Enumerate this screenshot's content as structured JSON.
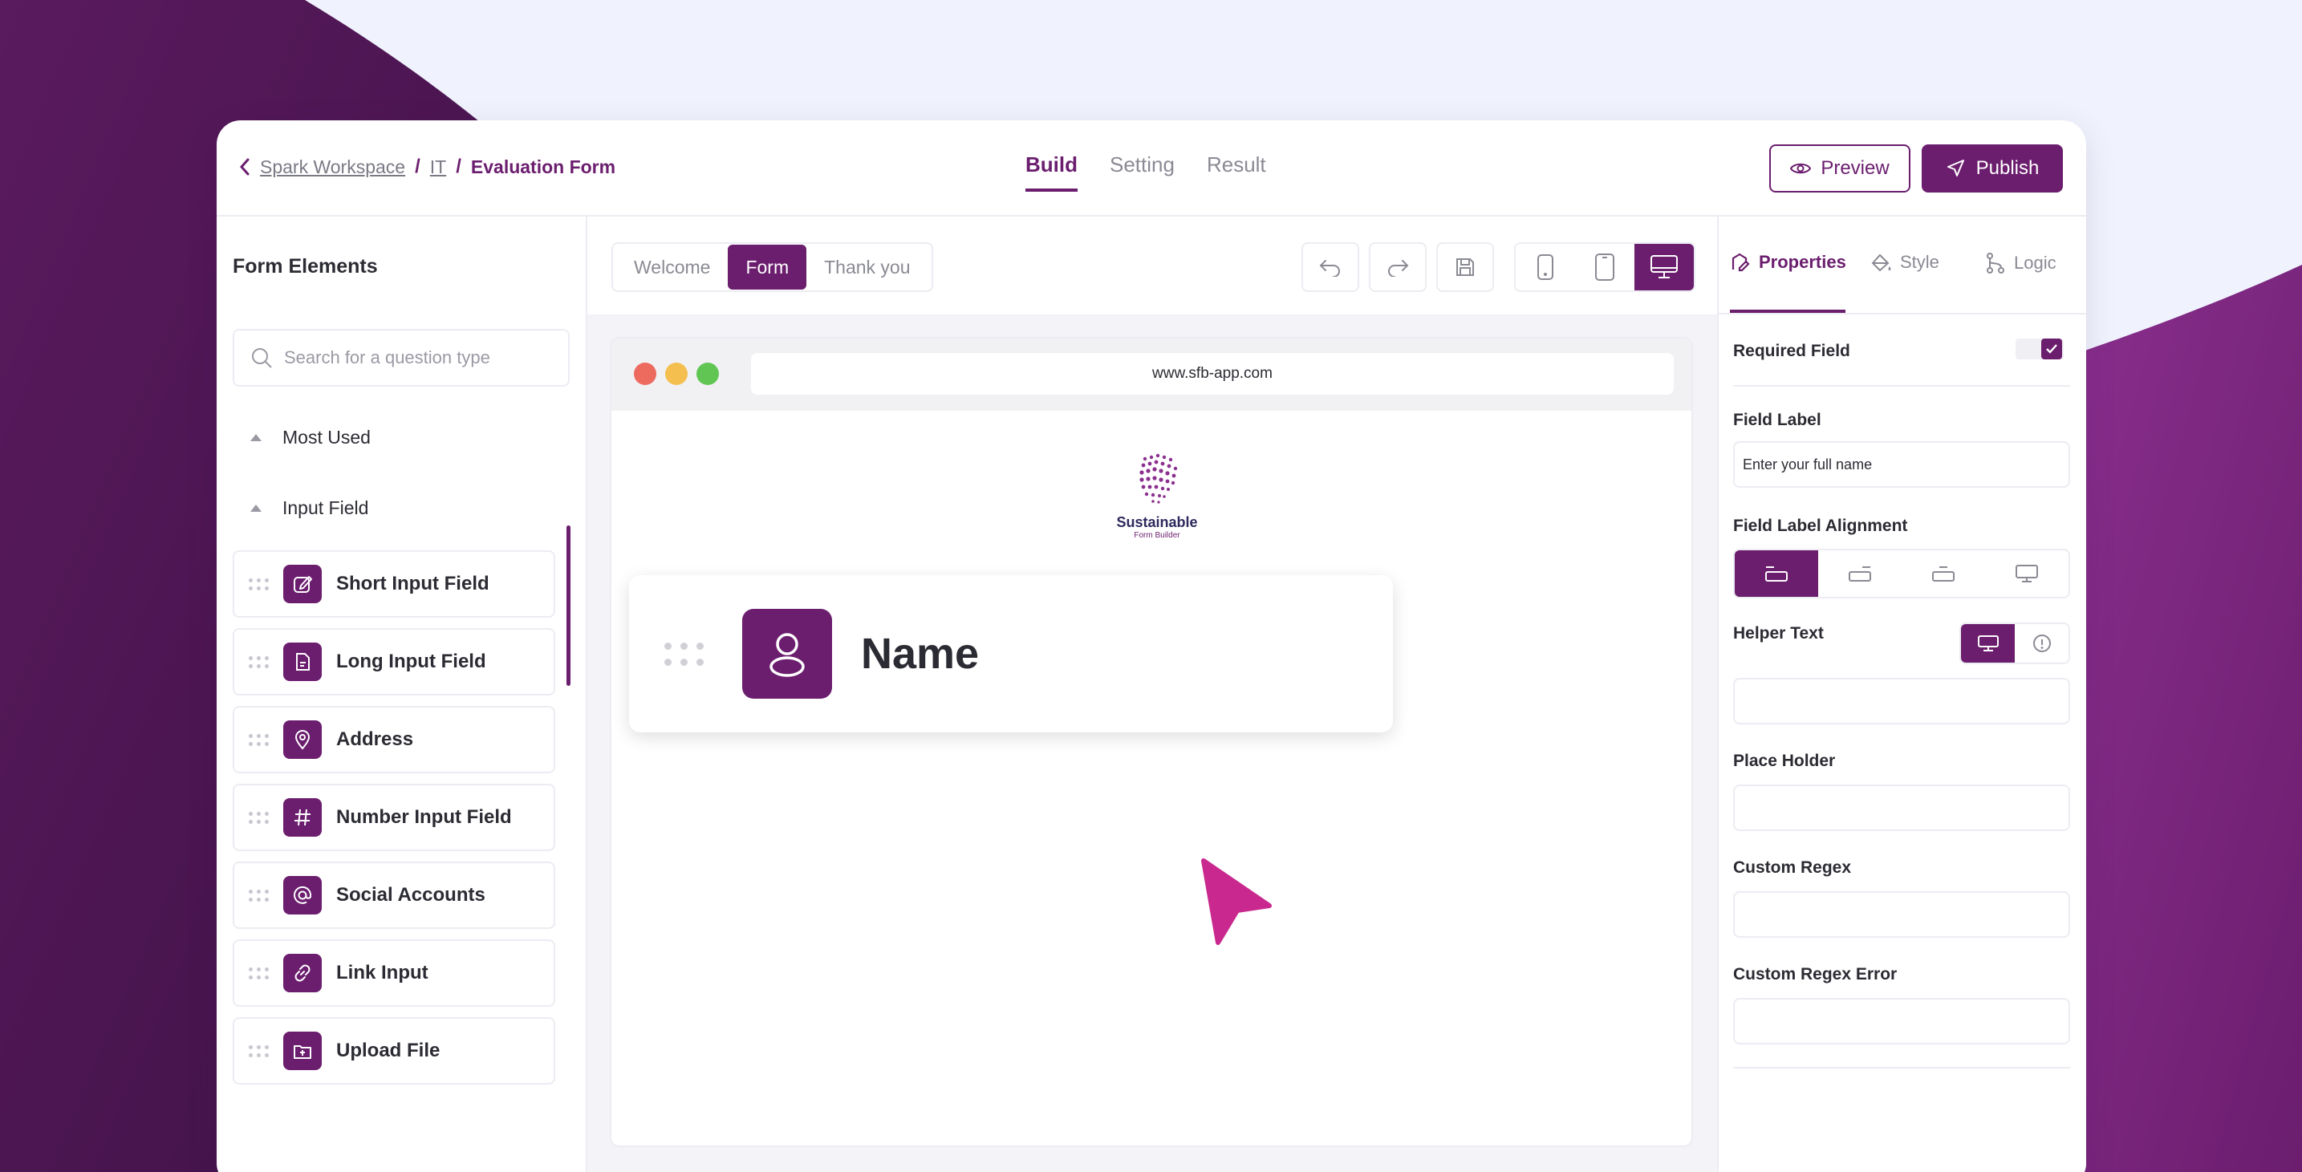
{
  "breadcrumb": {
    "workspace": "Spark Workspace",
    "folder": "IT",
    "current": "Evaluation Form",
    "separator": "/"
  },
  "topnav": {
    "tabs": [
      "Build",
      "Setting",
      "Result"
    ],
    "active": "Build"
  },
  "actions": {
    "preview": "Preview",
    "publish": "Publish"
  },
  "left_panel": {
    "title": "Form Elements",
    "search_placeholder": "Search for a question type",
    "categories": [
      "Most Used",
      "Input Field"
    ],
    "items": [
      {
        "label": "Short Input Field",
        "icon": "edit-icon"
      },
      {
        "label": "Long Input Field",
        "icon": "document-icon"
      },
      {
        "label": "Address",
        "icon": "location-pin-icon"
      },
      {
        "label": "Number Input Field",
        "icon": "hash-icon"
      },
      {
        "label": "Social Accounts",
        "icon": "at-sign-icon"
      },
      {
        "label": "Link Input",
        "icon": "link-icon"
      },
      {
        "label": "Upload File",
        "icon": "upload-folder-icon"
      }
    ]
  },
  "page_tabs": {
    "items": [
      "Welcome",
      "Form",
      "Thank you"
    ],
    "active": "Form"
  },
  "canvas": {
    "url": "www.sfb-app.com",
    "logo_title": "Sustainable",
    "logo_subtitle": "Form Builder",
    "field_label": "Name"
  },
  "right_panel": {
    "tabs": [
      "Properties",
      "Style",
      "Logic"
    ],
    "active_tab": "Properties",
    "required_field": "Required Field",
    "required_checked": true,
    "field_label_title": "Field Label",
    "field_label_value": "Enter your full name",
    "alignment_title": "Field Label Alignment",
    "helper_text": "Helper Text",
    "placeholder": "Place Holder",
    "custom_regex": "Custom Regex",
    "custom_regex_error": "Custom Regex Error"
  },
  "colors": {
    "brand": "#6b1d6e",
    "accent_cursor": "#c9298e",
    "background": "#f0f3fd"
  }
}
